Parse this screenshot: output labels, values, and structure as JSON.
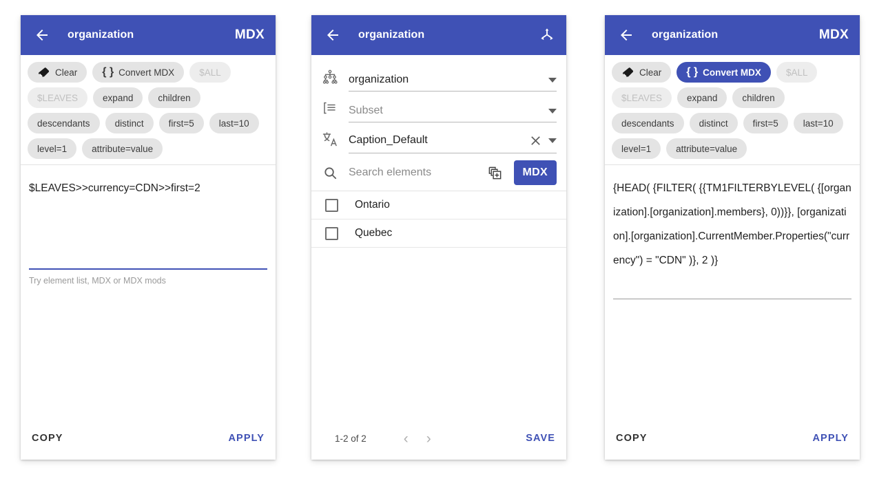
{
  "theme": {
    "primary": "#3f51b5",
    "chip_bg": "#e4e4e4",
    "chip_disabled_bg": "#ededed",
    "chip_disabled_text": "#c0c0c0",
    "text": "#1f1f1f",
    "hint": "#9a9a9a"
  },
  "panels": {
    "editor": {
      "appbar": {
        "back_icon": "arrow-back-icon",
        "title": "organization",
        "action_label": "MDX"
      },
      "chips": [
        [
          {
            "label": "Clear",
            "icon": "eraser-icon",
            "state": "enabled"
          },
          {
            "label": "Convert MDX",
            "icon": "curly-braces-icon",
            "state": "enabled"
          },
          {
            "label": "$ALL",
            "icon": "",
            "state": "disabled"
          }
        ],
        [
          {
            "label": "$LEAVES",
            "icon": "",
            "state": "disabled"
          },
          {
            "label": "expand",
            "icon": "",
            "state": "enabled"
          },
          {
            "label": "children",
            "icon": "",
            "state": "enabled"
          }
        ],
        [
          {
            "label": "descendants",
            "icon": "",
            "state": "enabled"
          },
          {
            "label": "distinct",
            "icon": "",
            "state": "enabled"
          },
          {
            "label": "first=5",
            "icon": "",
            "state": "enabled"
          },
          {
            "label": "last=10",
            "icon": "",
            "state": "enabled"
          }
        ],
        [
          {
            "label": "level=1",
            "icon": "",
            "state": "enabled"
          },
          {
            "label": "attribute=value",
            "icon": "",
            "state": "enabled"
          }
        ]
      ],
      "expression": "$LEAVES>>currency=CDN>>first=2",
      "hint": "Try element list, MDX or MDX mods",
      "footer": {
        "left_label": "COPY",
        "right_label": "APPLY"
      }
    },
    "picker": {
      "appbar": {
        "back_icon": "arrow-back-icon",
        "title": "organization",
        "action_icon": "dimension-axes-icon"
      },
      "selectors": [
        {
          "icon": "hierarchy-icon",
          "value": "organization",
          "placeholder": "",
          "is_placeholder": false,
          "has_clear": false
        },
        {
          "icon": "subset-list-icon",
          "value": "Subset",
          "placeholder": "Subset",
          "is_placeholder": true,
          "has_clear": false
        },
        {
          "icon": "translate-icon",
          "value": "Caption_Default",
          "placeholder": "",
          "is_placeholder": false,
          "has_clear": true
        }
      ],
      "search": {
        "icon": "search-icon",
        "value": "",
        "placeholder": "Search elements",
        "copy_icon": "copy-add-icon",
        "mdx_label": "MDX"
      },
      "elements": [
        {
          "label": "Ontario",
          "checked": false
        },
        {
          "label": "Quebec",
          "checked": false
        }
      ],
      "paginator": {
        "range_label": "1-2 of 2",
        "prev_icon": "chevron-left-icon",
        "next_icon": "chevron-right-icon",
        "save_label": "SAVE"
      }
    },
    "result": {
      "appbar": {
        "back_icon": "arrow-back-icon",
        "title": "organization",
        "action_label": "MDX"
      },
      "chips": [
        [
          {
            "label": "Clear",
            "icon": "eraser-icon",
            "state": "enabled"
          },
          {
            "label": "Convert MDX",
            "icon": "curly-braces-icon",
            "state": "active"
          },
          {
            "label": "$ALL",
            "icon": "",
            "state": "disabled"
          }
        ],
        [
          {
            "label": "$LEAVES",
            "icon": "",
            "state": "disabled"
          },
          {
            "label": "expand",
            "icon": "",
            "state": "enabled"
          },
          {
            "label": "children",
            "icon": "",
            "state": "enabled"
          }
        ],
        [
          {
            "label": "descendants",
            "icon": "",
            "state": "enabled"
          },
          {
            "label": "distinct",
            "icon": "",
            "state": "enabled"
          },
          {
            "label": "first=5",
            "icon": "",
            "state": "enabled"
          },
          {
            "label": "last=10",
            "icon": "",
            "state": "enabled"
          }
        ],
        [
          {
            "label": "level=1",
            "icon": "",
            "state": "enabled"
          },
          {
            "label": "attribute=value",
            "icon": "",
            "state": "enabled"
          }
        ]
      ],
      "expression": "{HEAD( {FILTER( {{TM1FILTERBYLEVEL( {[organization].[organization].members}, 0))}}, [organization].[organization].CurrentMember.Properties(\"currency\") = \"CDN\" )}, 2 )}",
      "footer": {
        "left_label": "COPY",
        "right_label": "APPLY"
      }
    }
  }
}
